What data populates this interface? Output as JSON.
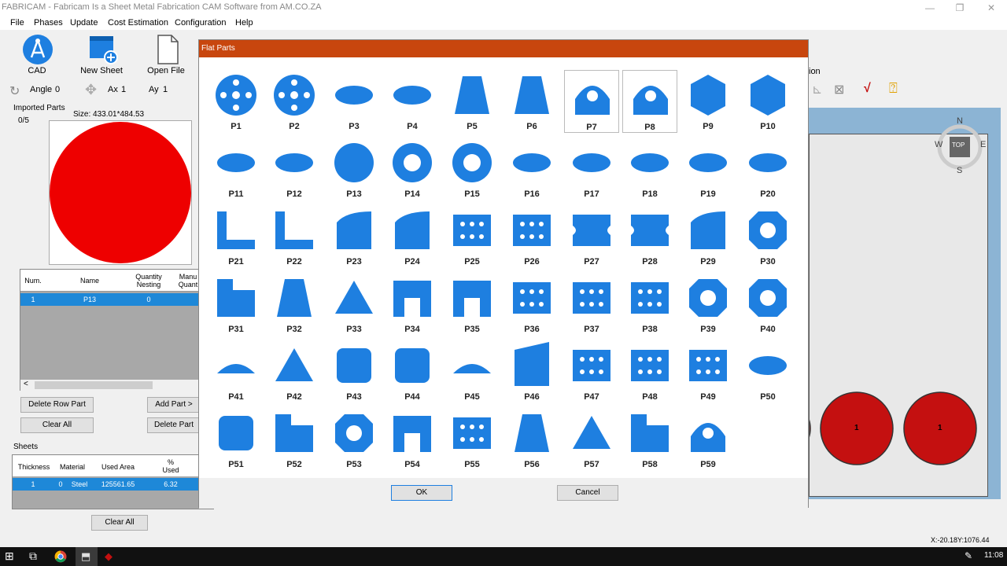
{
  "app": {
    "title": "FABRICAM - Fabricam Is a Sheet Metal Fabrication CAM Software from AM.CO.ZA"
  },
  "menu": [
    "File",
    "Phases",
    "Update",
    "Cost Estimation",
    "Configuration",
    "Help"
  ],
  "toolbar": {
    "cad_label": "CAD",
    "new_sheet_label": "New Sheet",
    "open_file_label": "Open File",
    "angle_label": "Angle",
    "angle_value": "0",
    "ax_label": "Ax",
    "ax_value": "1",
    "ay_label": "Ay",
    "ay_value": "1",
    "right_label": "ion"
  },
  "imported": {
    "group_label": "Imported Parts",
    "count": "0/5",
    "size_label": "Size: 433.01*484.53",
    "columns": [
      "Num.",
      "Name",
      "Quantity Nesting",
      "Manu Quant"
    ],
    "row": {
      "num": "1",
      "name": "P13",
      "qty": "0"
    },
    "scroll_left": "<",
    "delete_row_label": "Delete Row Part",
    "add_part_label": "Add Part >",
    "clear_all_label": "Clear All",
    "delete_part_label": "Delete Part"
  },
  "sheets": {
    "group_label": "Sheets",
    "columns": [
      "Thickness",
      "Material",
      "Used Area",
      "% Used"
    ],
    "row": {
      "thickness": "1",
      "material_num": "0",
      "material": "Steel",
      "used_area": "125561.65",
      "used_pct": "6.32"
    },
    "clear_all_label": "Clear All"
  },
  "dialog": {
    "title": "Flat Parts",
    "ok_label": "OK",
    "cancel_label": "Cancel",
    "parts": [
      "P1",
      "P2",
      "P3",
      "P4",
      "P5",
      "P6",
      "P7",
      "P8",
      "P9",
      "P10",
      "P11",
      "P12",
      "P13",
      "P14",
      "P15",
      "P16",
      "P17",
      "P18",
      "P19",
      "P20",
      "P21",
      "P22",
      "P23",
      "P24",
      "P25",
      "P26",
      "P27",
      "P28",
      "P29",
      "P30",
      "P31",
      "P32",
      "P33",
      "P34",
      "P35",
      "P36",
      "P37",
      "P38",
      "P39",
      "P40",
      "P41",
      "P42",
      "P43",
      "P44",
      "P45",
      "P46",
      "P47",
      "P48",
      "P49",
      "P50",
      "P51",
      "P52",
      "P53",
      "P54",
      "P55",
      "P56",
      "P57",
      "P58",
      "P59"
    ]
  },
  "viewcube": {
    "n": "N",
    "s": "S",
    "w": "W",
    "e": "E",
    "top": "TOP"
  },
  "canvas": {
    "part_label_1": "1",
    "part_label_2": "1"
  },
  "status": {
    "coords": "X:-20.18Y:1076.44"
  },
  "taskbar": {
    "time": "11:08"
  },
  "colors": {
    "part_blue": "#1e7fe0",
    "title_orange": "#c8460e",
    "selection": "#1e88d8",
    "nest_red": "#c41010"
  }
}
